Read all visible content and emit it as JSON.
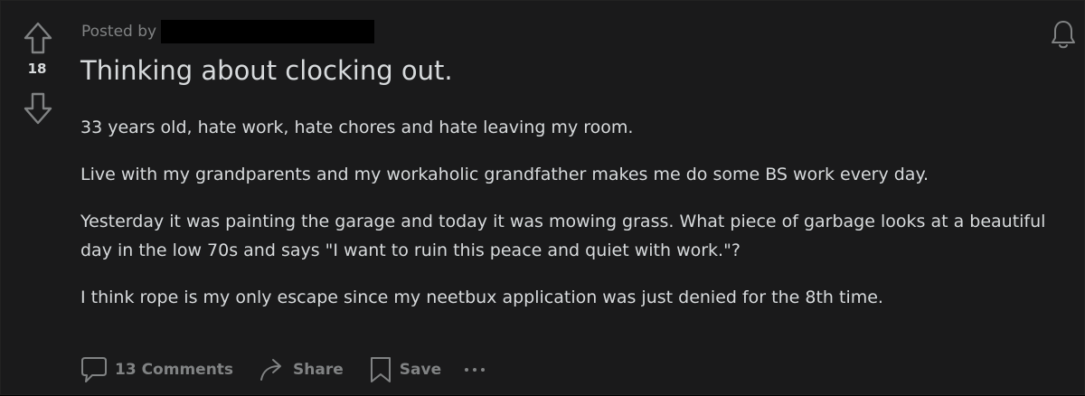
{
  "post": {
    "score": "18",
    "posted_by_label": "Posted by",
    "title": "Thinking about clocking out.",
    "paragraphs": [
      "33 years old, hate work, hate chores and hate leaving my room.",
      "Live with my grandparents and my workaholic grandfather makes me do some BS work every day.",
      "Yesterday it was painting the garage and today it was mowing grass. What piece of garbage looks at a beautiful day in the low 70s and says \"I want to ruin this peace and quiet with work.\"?",
      "I think rope is my only escape since my neetbux application was just denied for the 8th time."
    ]
  },
  "actions": {
    "comments_label": "13 Comments",
    "share_label": "Share",
    "save_label": "Save"
  },
  "icons": {
    "upvote": "arrow-up-icon",
    "downvote": "arrow-down-icon",
    "notification": "bell-icon",
    "comments": "comment-bubble-icon",
    "share": "share-arrow-icon",
    "save": "bookmark-icon",
    "more": "more-dots-icon"
  },
  "colors": {
    "background": "#1a1a1b",
    "text_primary": "#d7dadc",
    "text_secondary": "#818384"
  }
}
